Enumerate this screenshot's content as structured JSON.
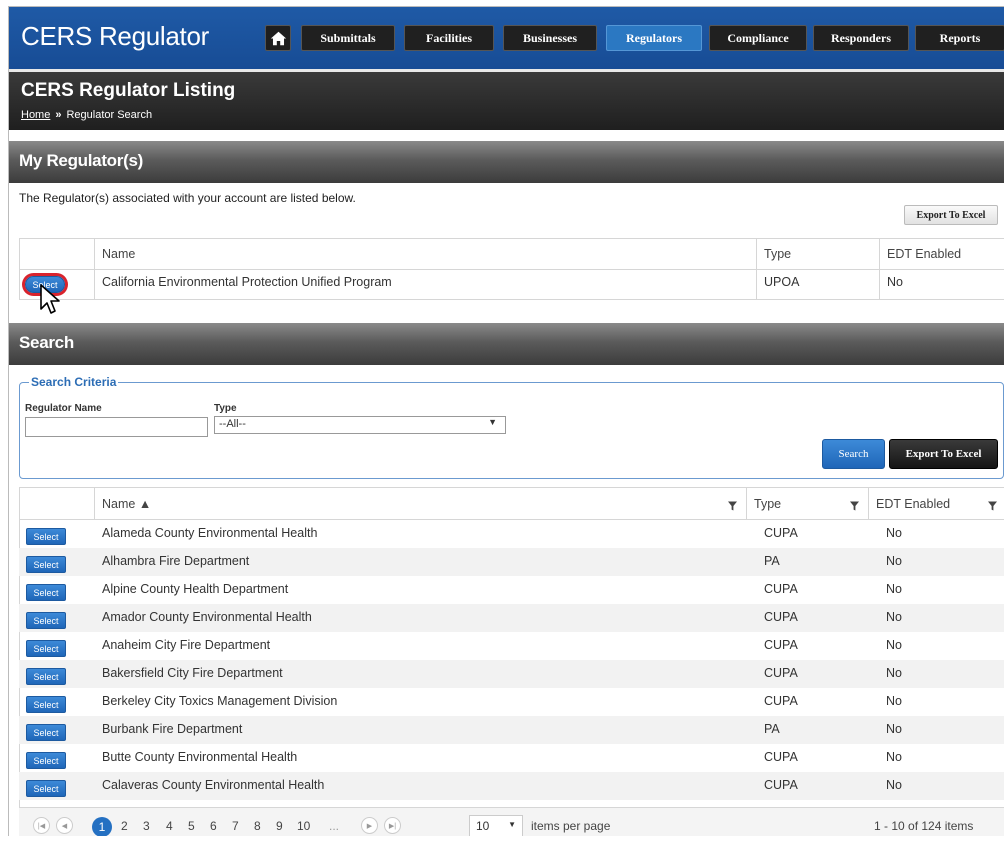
{
  "topnav": {
    "brand": "CERS Regulator",
    "items": [
      "Submittals",
      "Facilities",
      "Businesses",
      "Regulators",
      "Compliance",
      "Responders",
      "Reports"
    ],
    "active": "Regulators"
  },
  "page": {
    "title": "CERS Regulator Listing",
    "breadcrumb_home": "Home",
    "breadcrumb_sep": "»",
    "breadcrumb_current": "Regulator Search"
  },
  "my_regulators": {
    "heading": "My Regulator(s)",
    "intro": "The Regulator(s) associated with your account are listed below.",
    "export_label": "Export To Excel",
    "columns": [
      "Name",
      "Type",
      "EDT Enabled"
    ],
    "rows": [
      {
        "select": "Select",
        "name": "California Environmental Protection Unified Program",
        "type": "UPOA",
        "edt": "No"
      }
    ]
  },
  "search": {
    "heading": "Search",
    "criteria_legend": "Search Criteria",
    "name_label": "Regulator Name",
    "name_value": "",
    "type_label": "Type",
    "type_value": "--All--",
    "search_button": "Search",
    "export_button": "Export To Excel"
  },
  "results": {
    "columns": [
      "Name ▲",
      "Type",
      "EDT Enabled"
    ],
    "rows": [
      {
        "select": "Select",
        "name": "Alameda County Environmental Health",
        "type": "CUPA",
        "edt": "No"
      },
      {
        "select": "Select",
        "name": "Alhambra Fire Department",
        "type": "PA",
        "edt": "No"
      },
      {
        "select": "Select",
        "name": "Alpine County Health Department",
        "type": "CUPA",
        "edt": "No"
      },
      {
        "select": "Select",
        "name": "Amador County Environmental Health",
        "type": "CUPA",
        "edt": "No"
      },
      {
        "select": "Select",
        "name": "Anaheim City Fire Department",
        "type": "CUPA",
        "edt": "No"
      },
      {
        "select": "Select",
        "name": "Bakersfield City Fire Department",
        "type": "CUPA",
        "edt": "No"
      },
      {
        "select": "Select",
        "name": "Berkeley City Toxics Management Division",
        "type": "CUPA",
        "edt": "No"
      },
      {
        "select": "Select",
        "name": "Burbank Fire Department",
        "type": "PA",
        "edt": "No"
      },
      {
        "select": "Select",
        "name": "Butte County Environmental Health",
        "type": "CUPA",
        "edt": "No"
      },
      {
        "select": "Select",
        "name": "Calaveras County Environmental Health",
        "type": "CUPA",
        "edt": "No"
      }
    ]
  },
  "pager": {
    "pages": [
      "1",
      "2",
      "3",
      "4",
      "5",
      "6",
      "7",
      "8",
      "9",
      "10",
      "..."
    ],
    "current_page": "1",
    "page_size": "10",
    "page_size_label": "items per page",
    "summary": "1 - 10 of 124 items"
  }
}
